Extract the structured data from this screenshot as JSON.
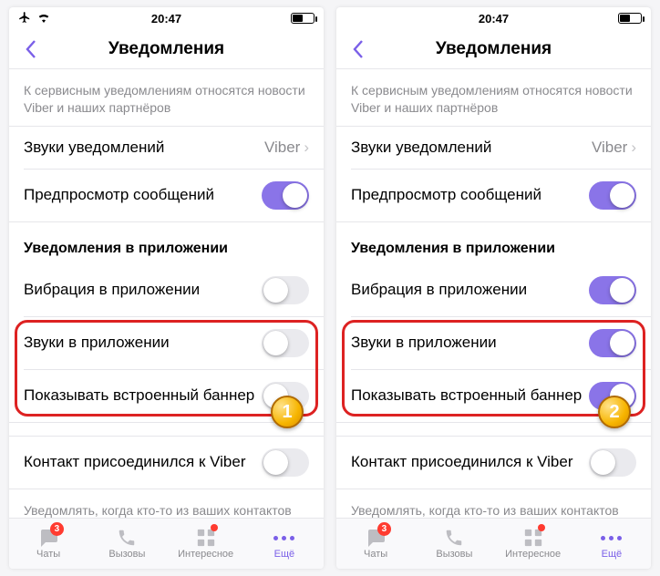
{
  "statusbar": {
    "time": "20:47"
  },
  "header": {
    "title": "Уведомления"
  },
  "desc": "К сервисным уведомлениям относятся новости Viber и наших партнёров",
  "rows": {
    "sounds": {
      "label": "Звуки уведомлений",
      "value": "Viber"
    },
    "preview": {
      "label": "Предпросмотр сообщений"
    },
    "section_inapp": "Уведомления в приложении",
    "vibration": {
      "label": "Вибрация в приложении"
    },
    "inapp_sounds": {
      "label": "Звуки в приложении"
    },
    "banner": {
      "label": "Показывать встроенный баннер"
    },
    "contact_joined": {
      "label": "Контакт присоединился к Viber"
    },
    "footer": "Уведомлять, когда кто-то из ваших контактов присоединяется к Viber"
  },
  "screens": [
    {
      "toggles": {
        "preview": true,
        "vibration": false,
        "inapp_sounds": false,
        "banner": false,
        "contact_joined": false
      },
      "step": "1"
    },
    {
      "toggles": {
        "preview": true,
        "vibration": true,
        "inapp_sounds": true,
        "banner": true,
        "contact_joined": false
      },
      "step": "2"
    }
  ],
  "tabs": {
    "chats": {
      "label": "Чаты",
      "badge": "3"
    },
    "calls": {
      "label": "Вызовы"
    },
    "explore": {
      "label": "Интересное",
      "dot": true
    },
    "more": {
      "label": "Ещё"
    }
  }
}
